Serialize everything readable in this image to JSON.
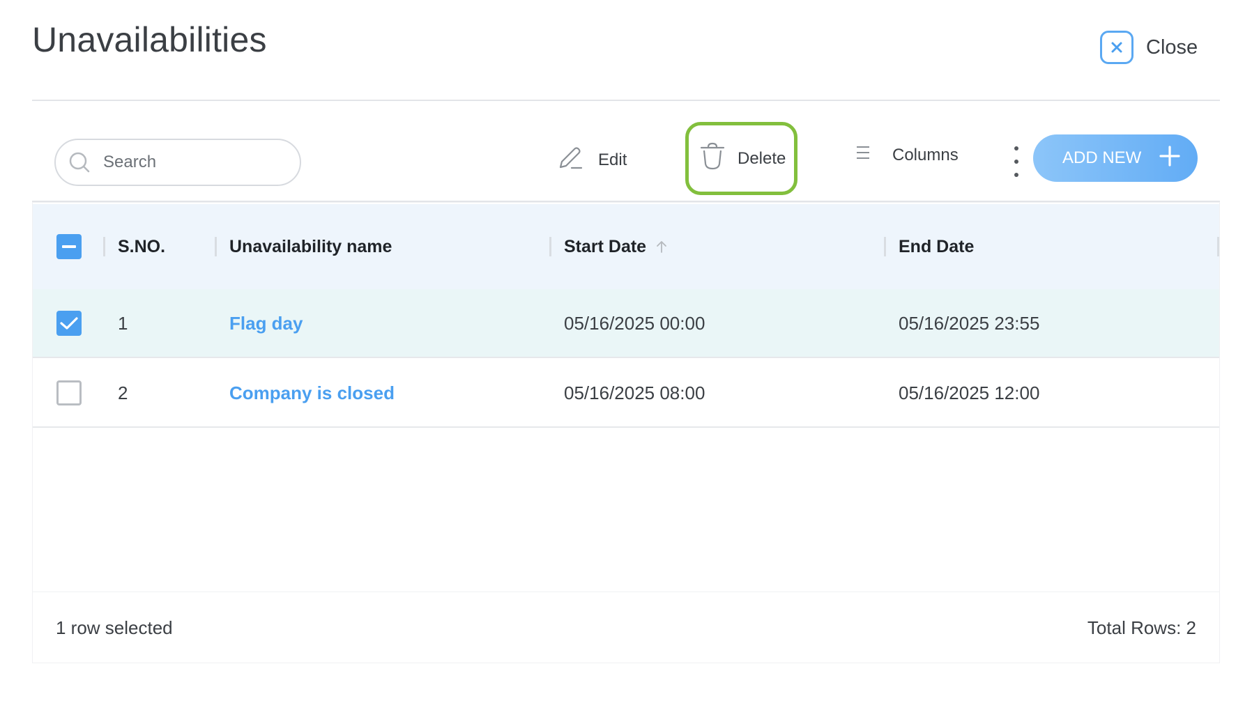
{
  "header": {
    "title": "Unavailabilities",
    "close_label": "Close"
  },
  "toolbar": {
    "search_placeholder": "Search",
    "edit_label": "Edit",
    "delete_label": "Delete",
    "columns_label": "Columns",
    "add_new_label": "ADD NEW"
  },
  "table": {
    "columns": [
      "S.NO.",
      "Unavailability name",
      "Start Date",
      "End Date"
    ],
    "sorted_column": "Start Date",
    "sort_direction": "ascending",
    "rows": [
      {
        "sno": "1",
        "name": "Flag day",
        "start": "05/16/2025 00:00",
        "end": "05/16/2025 23:55",
        "selected": true
      },
      {
        "sno": "2",
        "name": "Company is closed",
        "start": "05/16/2025 08:00",
        "end": "05/16/2025 12:00",
        "selected": false
      }
    ]
  },
  "footer": {
    "selection_status": "1 row selected",
    "total_rows": "Total Rows: 2"
  },
  "colors": {
    "accent": "#4a9ff0",
    "highlight_outline": "#82bf3d",
    "selected_row": "#eaf6f7",
    "header_bg": "#eef5fc"
  },
  "icons": [
    "x-icon",
    "search-icon",
    "pencil-icon",
    "trash-icon",
    "menu-lines-icon",
    "more-vertical-icon",
    "plus-icon",
    "check-icon",
    "minus-icon",
    "sort-up-arrow-icon"
  ]
}
